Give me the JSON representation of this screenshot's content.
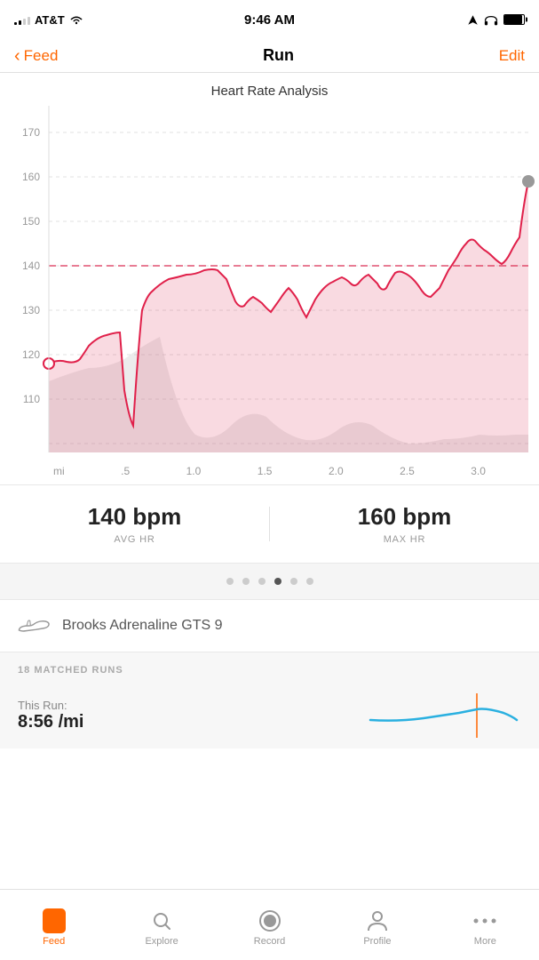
{
  "statusBar": {
    "carrier": "AT&T",
    "time": "9:46 AM",
    "signalBars": [
      3,
      5,
      7,
      9,
      11
    ]
  },
  "header": {
    "backLabel": "Feed",
    "title": "Run",
    "editLabel": "Edit"
  },
  "chart": {
    "title": "Heart Rate Analysis",
    "avgHR": "140 bpm",
    "avgHRLabel": "AVG HR",
    "maxHR": "160 bpm",
    "maxHRLabel": "MAX HR",
    "xLabels": [
      "mi",
      ".5",
      "1.0",
      "1.5",
      "2.0",
      "2.5",
      "3.0"
    ]
  },
  "pagination": {
    "dots": 6,
    "activeIndex": 3
  },
  "shoe": {
    "name": "Brooks Adrenaline GTS 9"
  },
  "matchedRuns": {
    "count": "18",
    "label": "MATCHED RUNS",
    "thisRunLabel": "This Run:",
    "thisRunPace": "8:56 /mi"
  },
  "tabBar": {
    "tabs": [
      {
        "id": "feed",
        "label": "Feed",
        "active": true
      },
      {
        "id": "explore",
        "label": "Explore",
        "active": false
      },
      {
        "id": "record",
        "label": "Record",
        "active": false
      },
      {
        "id": "profile",
        "label": "Profile",
        "active": false
      },
      {
        "id": "more",
        "label": "More",
        "active": false
      }
    ]
  }
}
